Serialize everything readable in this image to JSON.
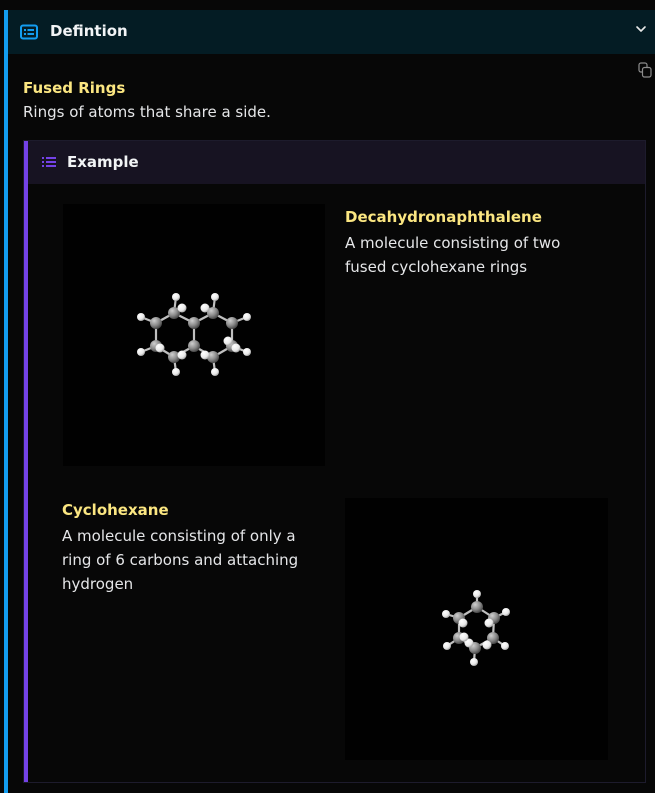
{
  "callout": {
    "title": "Defintion",
    "icon": "list-card-icon",
    "accent": "#139df0"
  },
  "definition": {
    "term": "Fused Rings",
    "description": "Rings of atoms that share a side."
  },
  "example": {
    "title": "Example",
    "accent": "#7442e7",
    "items": [
      {
        "title": "Decahydronaphthalene",
        "description_lines": [
          "A molecule consisting of two",
          "fused cyclohexane rings"
        ],
        "image": "decahydronaphthalene-molecule-model"
      },
      {
        "title": "Cyclohexane",
        "description_lines": [
          "A molecule consisting of only a",
          "ring of 6 carbons and attaching",
          "hydrogen"
        ],
        "image": "cyclohexane-molecule-model"
      }
    ]
  },
  "colors": {
    "term": "#fbe681",
    "text": "#e5e6e8",
    "carbon": "#8a8a8a",
    "hydrogen": "#f5f5f5"
  }
}
